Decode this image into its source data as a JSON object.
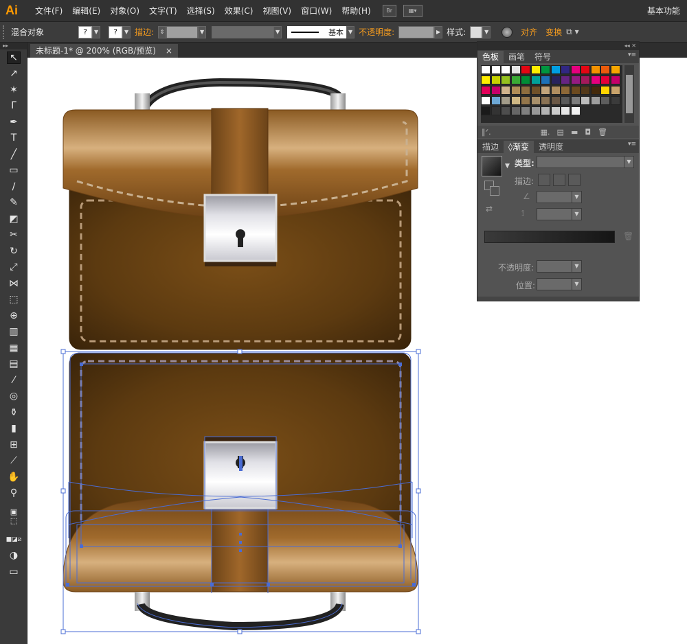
{
  "app": {
    "logo": "Ai",
    "workspace": "基本功能"
  },
  "menu": [
    "文件(F)",
    "编辑(E)",
    "对象(O)",
    "文字(T)",
    "选择(S)",
    "效果(C)",
    "视图(V)",
    "窗口(W)",
    "帮助(H)"
  ],
  "menu_br": "Br",
  "control": {
    "object_type": "混合对象",
    "fill_placeholder": "?",
    "stroke_placeholder": "?",
    "stroke_label": "描边:",
    "stroke_style": "基本",
    "opacity_label": "不透明度:",
    "style_label": "样式:",
    "align_label": "对齐",
    "transform_label": "变换"
  },
  "document": {
    "tab_title": "未标题-1* @ 200% (RGB/预览)",
    "close_glyph": "×"
  },
  "swatch_panel": {
    "tabs": [
      "色板",
      "画笔",
      "符号"
    ],
    "active_tab": 0,
    "colors": [
      [
        "#ffffff",
        "#ffffff",
        "#ffffff",
        "#e6e6e6",
        "#e30613",
        "#ffed00",
        "#009640",
        "#009fe3",
        "#312783",
        "#e6007e",
        "#e30613",
        "#f39200",
        "#ea5b0c",
        "#f7a600"
      ],
      [
        "#ffed00",
        "#c6d100",
        "#95c11f",
        "#3aaa35",
        "#008d36",
        "#00a19a",
        "#1d71b8",
        "#29235c",
        "#662483",
        "#951b81",
        "#a3195b",
        "#e6007e",
        "#e4003a",
        "#c5006a"
      ],
      [
        "#e4005a",
        "#c5006a",
        "#d0b38c",
        "#b08d57",
        "#8e6d3e",
        "#705129",
        "#c2a47b",
        "#b18e60",
        "#8d6837",
        "#6c4a1f",
        "#53391a",
        "#442a0c",
        "#ffd400",
        "#c9a36b"
      ],
      [
        "#ffffff",
        "#6da8d6",
        "#a39c8a",
        "#cfb885",
        "#94764b",
        "#a8906b",
        "#8b7355",
        "#6b5846",
        "#5a5a5a",
        "#7e7e7e",
        "#bdbdbd",
        "#9e9e9e",
        "#5e5e5e",
        "#3b3b3b"
      ],
      [
        "#1a1a1a",
        "#333333",
        "#4d4d4d",
        "#666666",
        "#808080",
        "#999999",
        "#b3b3b3",
        "#cccccc",
        "#e6e6e6",
        "#f2f2f2"
      ]
    ]
  },
  "gradient_panel": {
    "tabs": [
      "描边",
      "渐变",
      "透明度"
    ],
    "type_label": "类型:",
    "stroke_label": "描边:",
    "opacity_label": "不透明度:",
    "position_label": "位置:"
  },
  "colors": {
    "accent": "#f29a1f",
    "selection": "#4a6cd4",
    "leather": "#8b5a22"
  }
}
